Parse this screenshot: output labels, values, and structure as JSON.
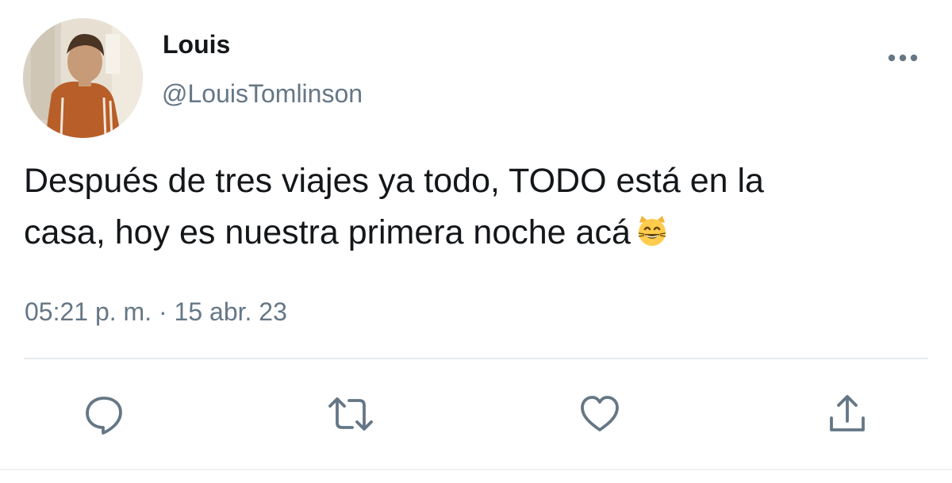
{
  "user": {
    "display_name": "Louis",
    "handle": "@LouisTomlinson",
    "avatar_icon": "profile-photo"
  },
  "tweet": {
    "line1": "Después de tres viajes ya todo, TODO está en la",
    "line2": "casa, hoy es nuestra primera noche acá",
    "emoji": "😸",
    "time": "05:21 p. m.",
    "separator": "·",
    "date": "15 abr. 23"
  },
  "actions": {
    "more_icon": "more-horizontal-icon",
    "reply_icon": "reply-icon",
    "retweet_icon": "retweet-icon",
    "like_icon": "heart-icon",
    "share_icon": "share-icon"
  },
  "colors": {
    "text": "#14171a",
    "secondary": "#657786",
    "divider": "#e6ecf0",
    "emoji_yellow": "#ffcc4d"
  }
}
